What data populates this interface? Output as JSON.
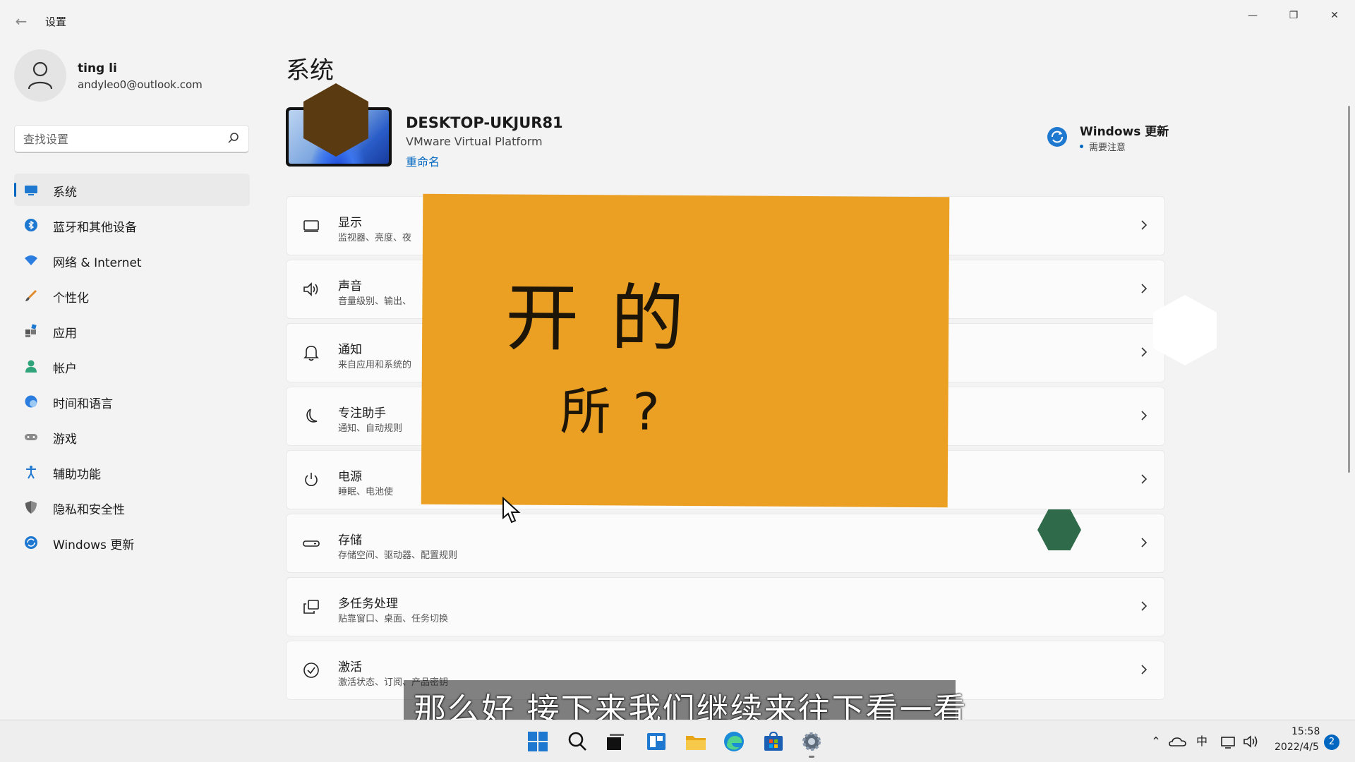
{
  "window": {
    "title": "设置",
    "back_icon": "back-arrow-icon",
    "controls": [
      "minimize-icon",
      "restore-icon",
      "close-icon"
    ]
  },
  "profile": {
    "name": "ting li",
    "email": "andyleo0@outlook.com"
  },
  "search": {
    "placeholder": "查找设置"
  },
  "sidebar": {
    "items": [
      {
        "label": "系统",
        "icon": "system-icon",
        "active": true
      },
      {
        "label": "蓝牙和其他设备",
        "icon": "bluetooth-icon"
      },
      {
        "label": "网络 & Internet",
        "icon": "network-icon"
      },
      {
        "label": "个性化",
        "icon": "personalization-icon"
      },
      {
        "label": "应用",
        "icon": "apps-icon"
      },
      {
        "label": "帐户",
        "icon": "account-icon"
      },
      {
        "label": "时间和语言",
        "icon": "time-language-icon"
      },
      {
        "label": "游戏",
        "icon": "gaming-icon"
      },
      {
        "label": "辅助功能",
        "icon": "accessibility-icon"
      },
      {
        "label": "隐私和安全性",
        "icon": "privacy-icon"
      },
      {
        "label": "Windows 更新",
        "icon": "windows-update-icon"
      }
    ]
  },
  "main": {
    "title": "系统",
    "device": {
      "name": "DESKTOP-UKJUR81",
      "model": "VMware Virtual Platform",
      "rename": "重命名"
    },
    "update": {
      "title": "Windows 更新",
      "status": "需要注意"
    },
    "cards": [
      {
        "title": "显示",
        "desc": "监视器、亮度、夜",
        "icon": "display-icon"
      },
      {
        "title": "声音",
        "desc": "音量级别、输出、",
        "icon": "sound-icon"
      },
      {
        "title": "通知",
        "desc": "来自应用和系统的",
        "icon": "notification-bell-icon"
      },
      {
        "title": "专注助手",
        "desc": "通知、自动规则",
        "icon": "focus-moon-icon"
      },
      {
        "title": "电源",
        "desc": "睡眠、电池使",
        "icon": "power-icon"
      },
      {
        "title": "存储",
        "desc": "存储空间、驱动器、配置规则",
        "icon": "storage-icon"
      },
      {
        "title": "多任务处理",
        "desc": "贴靠窗口、桌面、任务切换",
        "icon": "multitasking-icon"
      },
      {
        "title": "激活",
        "desc": "激活状态、订阅、产品密钥",
        "icon": "activation-check-icon"
      }
    ]
  },
  "overlay": {
    "line1": "开  的",
    "line2": "所  ?",
    "color": "#eba023"
  },
  "subtitle": "那么好  接下来我们继续来往下看一看",
  "taskbar": {
    "apps": [
      "start-icon",
      "search-icon",
      "task-view-icon",
      "widgets-icon",
      "file-explorer-icon",
      "edge-icon",
      "store-icon",
      "settings-gear-icon"
    ],
    "tray": {
      "ime": "中",
      "time": "15:58",
      "date": "2022/4/5",
      "notifications": "2"
    }
  },
  "colors": {
    "accent": "#0067c0",
    "background": "#f3f3f3"
  }
}
